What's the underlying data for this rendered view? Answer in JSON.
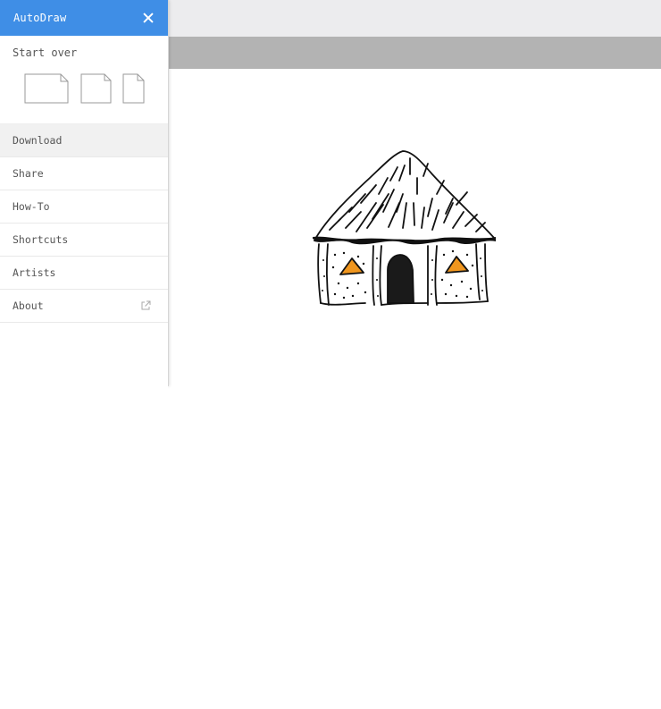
{
  "drawer": {
    "title": "AutoDraw",
    "start_over_label": "Start over",
    "page_formats": [
      "landscape",
      "square",
      "portrait"
    ],
    "menu_items": [
      {
        "label": "Download",
        "active": true
      },
      {
        "label": "Share"
      },
      {
        "label": "How-To"
      },
      {
        "label": "Shortcuts"
      },
      {
        "label": "Artists"
      },
      {
        "label": "About",
        "icon": "external-link-icon"
      }
    ]
  },
  "colors": {
    "header": "#3f8ee6",
    "toolbar": "#b3b3b3",
    "topbar": "#ececee",
    "window_fill": "#f0961e"
  },
  "canvas": {
    "drawing": "hut"
  }
}
